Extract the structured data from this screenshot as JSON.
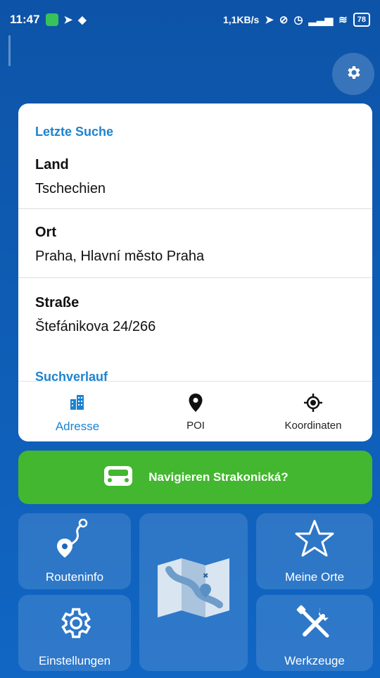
{
  "status_bar": {
    "time": "11:47",
    "speed": "1,1KB/s",
    "battery": "78"
  },
  "card": {
    "recent_title": "Letzte Suche",
    "fields": [
      {
        "label": "Land",
        "value": "Tschechien"
      },
      {
        "label": "Ort",
        "value": "Praha, Hlavní město Praha"
      },
      {
        "label": "Straße",
        "value": "Štefánikova 24/266"
      }
    ],
    "history_title": "Suchverlauf"
  },
  "tabs": [
    {
      "label": "Adresse",
      "icon": "city-icon",
      "active": true
    },
    {
      "label": "POI",
      "icon": "map-pin-icon",
      "active": false
    },
    {
      "label": "Koordinaten",
      "icon": "crosshair-icon",
      "active": false
    }
  ],
  "navigate_button": {
    "label": "Navigieren Strakonická?",
    "icon": "car-icon"
  },
  "tiles": {
    "route_info": {
      "label": "Routeninfo",
      "icon": "route-icon"
    },
    "map": {
      "icon": "map-icon"
    },
    "my_places": {
      "label": "Meine Orte",
      "icon": "star-icon"
    },
    "settings": {
      "label": "Einstellungen",
      "icon": "gear-icon"
    },
    "tools": {
      "label": "Werkzeuge",
      "icon": "tools-icon"
    }
  },
  "colors": {
    "accent": "#1d83d0",
    "navigate": "#43b72f",
    "background": "#0e5cb4"
  }
}
